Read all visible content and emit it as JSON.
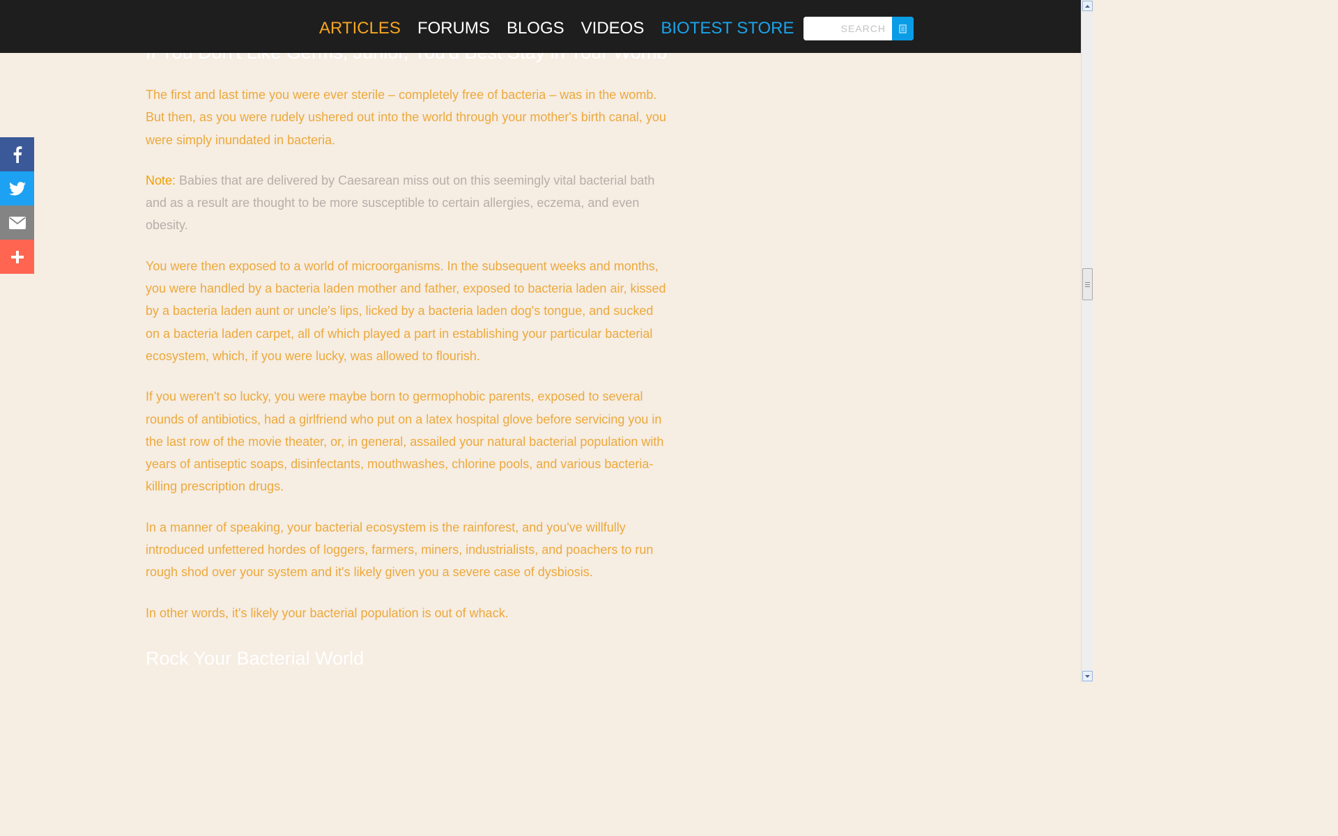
{
  "nav": {
    "items": [
      {
        "label": "ARTICLES",
        "state": "active"
      },
      {
        "label": "FORUMS",
        "state": ""
      },
      {
        "label": "BLOGS",
        "state": ""
      },
      {
        "label": "VIDEOS",
        "state": ""
      },
      {
        "label": "BIOTEST STORE",
        "state": "store"
      }
    ],
    "search_placeholder": "SEARCH"
  },
  "article": {
    "top_heading": "If You Don't Like Germs, Junior, You'd Best Stay in Your Womb",
    "p1": "The first and last time you were ever sterile – completely free of bacteria – was in the womb. But then, as you were rudely ushered out into the world through your mother's birth canal, you were simply inundated in bacteria.",
    "note_label": "Note:",
    "note_text": " Babies that are delivered by Caesarean miss out on this seemingly vital bacterial bath and as a result are thought to be more susceptible to certain allergies, eczema, and even obesity.",
    "p2": "You were then exposed to a world of microorganisms. In the subsequent weeks and months, you were handled by a bacteria laden mother and father, exposed to bacteria laden air, kissed by a bacteria laden aunt or uncle's lips, licked by a bacteria laden dog's tongue, and sucked on a bacteria laden carpet, all of which played a part in establishing your particular bacterial ecosystem, which, if you were lucky, was allowed to flourish.",
    "p3": "If you weren't so lucky, you were maybe born to germophobic parents, exposed to several rounds of antibiotics, had a girlfriend who put on a latex hospital glove before servicing you in the last row of the movie theater, or, in general, assailed your natural bacterial population with years of antiseptic soaps, disinfectants, mouthwashes, chlorine pools, and various bacteria-killing prescription drugs.",
    "p4": "In a manner of speaking, your bacterial ecosystem is the rainforest, and you've willfully introduced unfettered hordes of loggers, farmers, miners, industrialists, and poachers to run rough shod over your system and it's likely given you a severe case of dysbiosis.",
    "p5": "In other words, it's likely your bacterial population is out of whack.",
    "heading2": "Rock Your Bacterial World"
  },
  "share": {
    "icons": [
      "facebook-icon",
      "twitter-icon",
      "email-icon",
      "plus-icon"
    ]
  },
  "colors": {
    "header_bg": "#1e1e1e",
    "page_bg": "#f6ede3",
    "accent_orange": "#f5a623",
    "store_blue": "#1aa3ea",
    "body_text": "#eca93b",
    "note_text": "#b6b0aa"
  }
}
